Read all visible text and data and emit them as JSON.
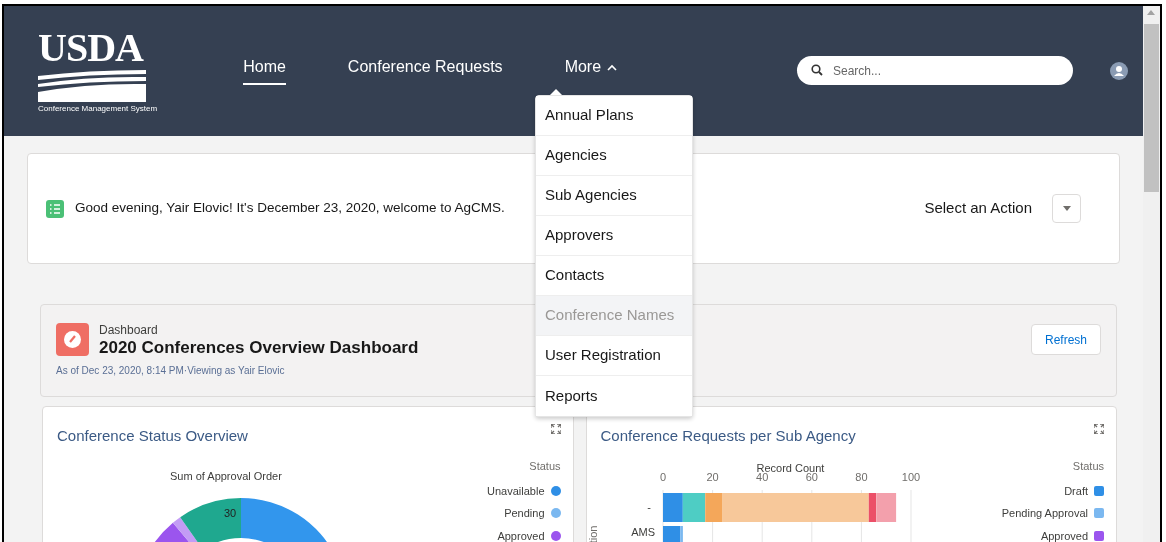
{
  "header": {
    "logo": {
      "wordmark": "USDA",
      "subtitle": "Conference Management System"
    },
    "nav": [
      {
        "label": "Home",
        "selected": true
      },
      {
        "label": "Conference Requests",
        "selected": false
      },
      {
        "label": "More",
        "selected": false,
        "expanded": true
      }
    ],
    "search": {
      "placeholder": "Search..."
    }
  },
  "more_menu": {
    "items": [
      {
        "label": "Annual Plans",
        "disabled": false
      },
      {
        "label": "Agencies",
        "disabled": false
      },
      {
        "label": "Sub Agencies",
        "disabled": false
      },
      {
        "label": "Approvers",
        "disabled": false
      },
      {
        "label": "Contacts",
        "disabled": false
      },
      {
        "label": "Conference Names",
        "disabled": true
      },
      {
        "label": "User Registration",
        "disabled": false
      },
      {
        "label": "Reports",
        "disabled": false
      }
    ]
  },
  "welcome": {
    "message": "Good evening, Yair Elovic! It's December 23, 2020, welcome to AgCMS.",
    "action_label": "Select an Action"
  },
  "dashboard": {
    "type_label": "Dashboard",
    "title": "2020 Conferences Overview Dashboard",
    "subtitle": "As of Dec 23, 2020, 8:14 PM·Viewing as Yair Elovic",
    "refresh": "Refresh"
  },
  "widgets": [
    {
      "kind": "donut",
      "title": "Conference Status Overview",
      "donut": {
        "title": "Sum of Approval Order",
        "segment_label": "30"
      },
      "legend": {
        "title": "Status",
        "items": [
          {
            "label": "Unavailable",
            "color": "#2f8fe6"
          },
          {
            "label": "Pending",
            "color": "#7bb8f0"
          },
          {
            "label": "Approved",
            "color": "#9b55ee"
          }
        ]
      }
    },
    {
      "kind": "bar",
      "title": "Conference Requests per Sub Agency",
      "chart_data": {
        "type": "bar",
        "orientation": "horizontal",
        "stacked": true,
        "grid": true,
        "xlabel": "Record Count",
        "ylabel": "tion",
        "categories": [
          "-",
          "AMS"
        ],
        "xticks": [
          0,
          20,
          40,
          60,
          80,
          100
        ],
        "xlim": [
          0,
          100
        ],
        "series": [
          {
            "name": "Draft",
            "color": "#2f8fe6",
            "values": [
              8,
              7
            ]
          },
          {
            "name": "Pending Approval",
            "color": "#7bb8f0",
            "values": [
              null,
              1
            ]
          },
          {
            "color": "#4ecdc4",
            "values": [
              9,
              null
            ]
          },
          {
            "color": "#f4a75a",
            "values": [
              7,
              null
            ]
          },
          {
            "color": "#f7c89a",
            "values": [
              59,
              null
            ]
          },
          {
            "color": "#ec4f68",
            "values": [
              3,
              null
            ]
          },
          {
            "color": "#f3a0ac",
            "values": [
              8,
              null
            ]
          },
          {
            "name": "Approved",
            "color": "#9b55ee",
            "values": [
              null,
              null
            ]
          }
        ]
      },
      "legend": {
        "title": "Status"
      }
    }
  ]
}
